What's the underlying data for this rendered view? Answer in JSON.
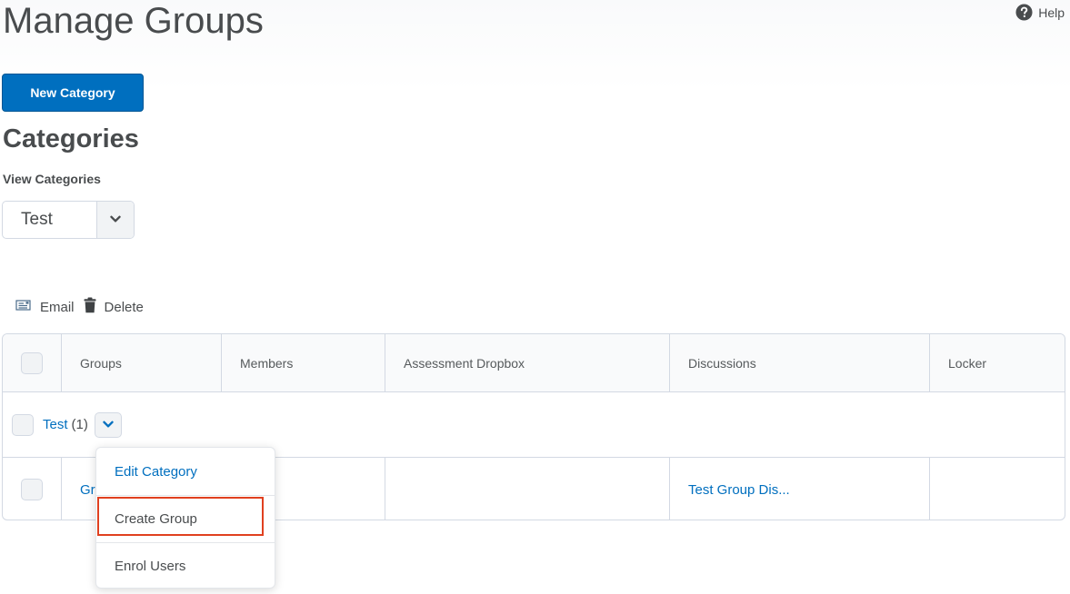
{
  "header": {
    "title": "Manage Groups",
    "help_label": "Help",
    "help_icon": "help-circle-icon"
  },
  "toolbar": {
    "new_category_label": "New Category"
  },
  "categories_section": {
    "title": "Categories",
    "view_label": "View Categories",
    "selected_category": "Test"
  },
  "actions": {
    "email_label": "Email",
    "email_icon": "email-icon",
    "delete_label": "Delete",
    "delete_icon": "trash-icon"
  },
  "table": {
    "columns": [
      "Groups",
      "Members",
      "Assessment Dropbox",
      "Discussions",
      "Locker"
    ],
    "category_row": {
      "name": "Test",
      "count": "(1)"
    },
    "rows": [
      {
        "group": "Gr",
        "members": "",
        "assessment_dropbox": "",
        "discussions": "Test Group Dis...",
        "locker": ""
      }
    ]
  },
  "context_menu": {
    "items": [
      "Edit Category",
      "Create Group",
      "Enrol Users"
    ],
    "highlighted_item": "Create Group",
    "highlight_color": "#e0401f"
  },
  "colors": {
    "primary": "#006fbf",
    "text": "#494c4e",
    "border": "#d3d9e3"
  }
}
